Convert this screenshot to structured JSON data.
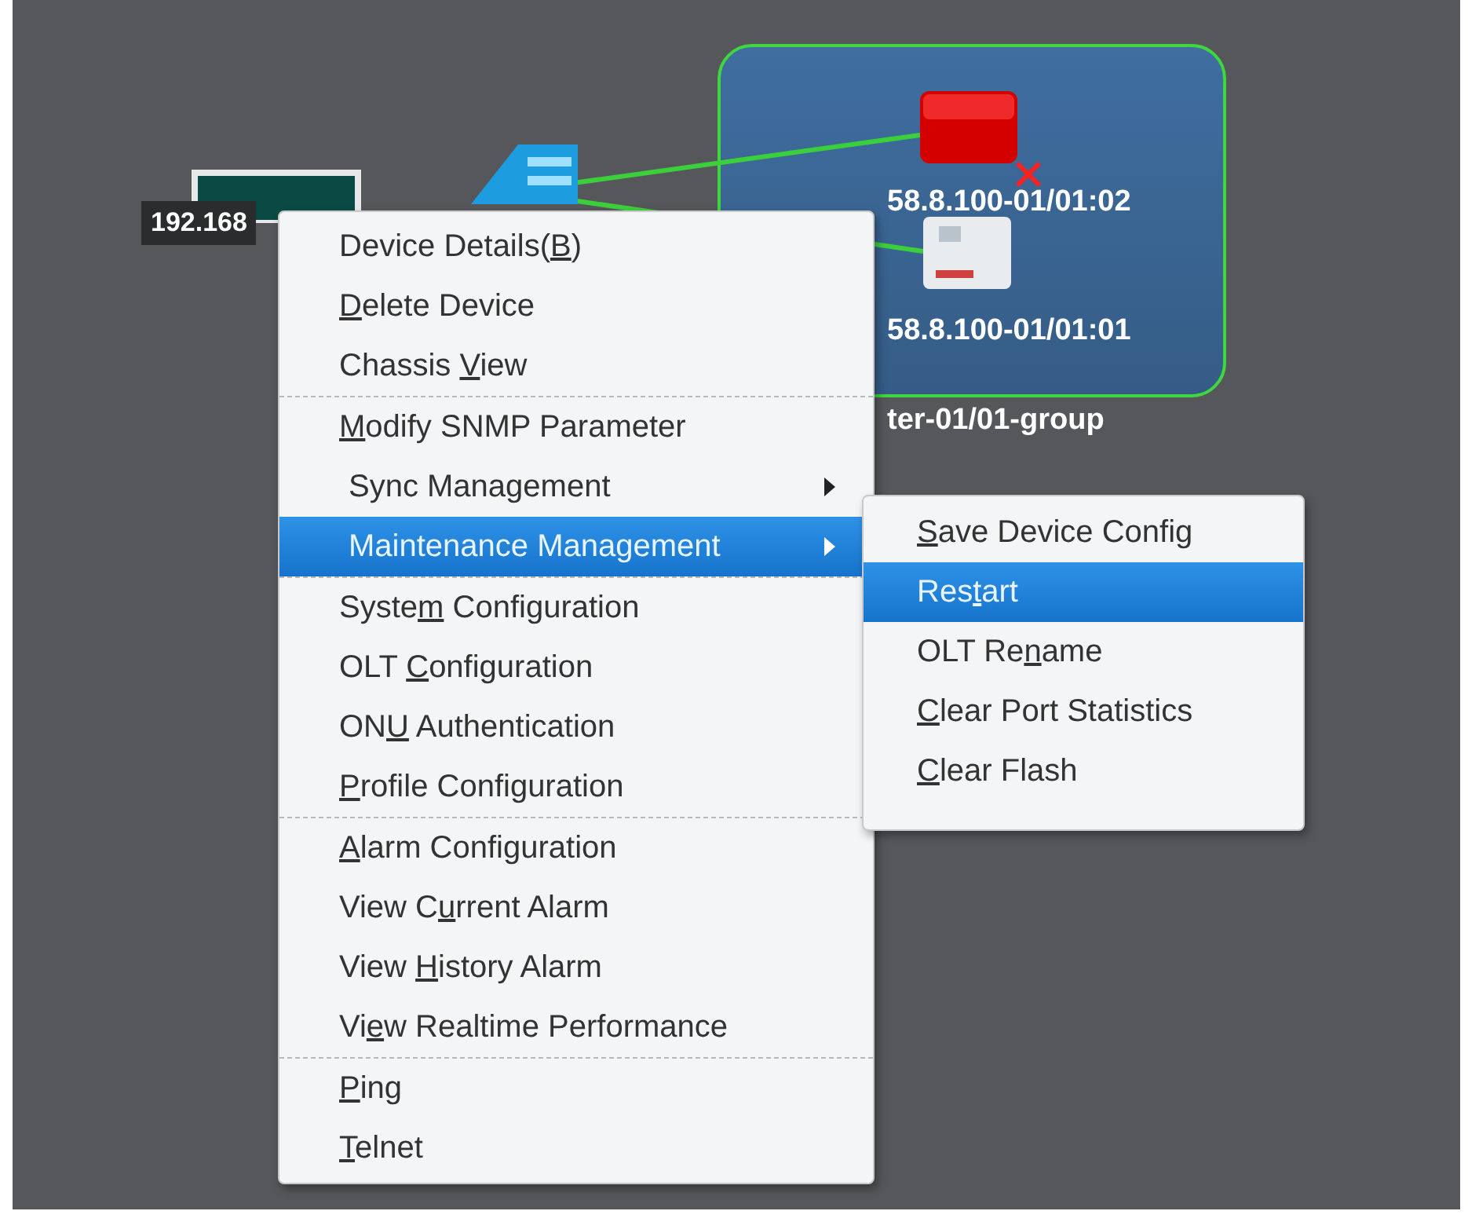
{
  "canvas": {
    "labels": [
      {
        "kind": "tag",
        "text": "192.168"
      },
      {
        "kind": "plain",
        "text": "58.8.100-01/01:02"
      },
      {
        "kind": "plain",
        "text": "58.8.100-01/01:01"
      },
      {
        "kind": "plain",
        "text": "ter-01/01-group"
      }
    ]
  },
  "context_menu": {
    "items": [
      {
        "kind": "item",
        "before": "Device Details(",
        "key": "B",
        "after": ")",
        "selected": false
      },
      {
        "kind": "item",
        "key": "D",
        "after": "elete Device",
        "selected": false
      },
      {
        "kind": "item",
        "before": "Chassis ",
        "key": "V",
        "after": "iew",
        "selected": false
      },
      {
        "kind": "separator"
      },
      {
        "kind": "item",
        "key": "M",
        "after": "odify SNMP Parameter",
        "selected": false
      },
      {
        "kind": "submenu",
        "before": "Sync Management",
        "selected": false
      },
      {
        "kind": "submenu",
        "before": "Maintenance Management",
        "selected": true
      },
      {
        "kind": "separator"
      },
      {
        "kind": "item",
        "before": "Syste",
        "key": "m",
        "after": " Configuration",
        "selected": false
      },
      {
        "kind": "item",
        "before": "OLT ",
        "key": "C",
        "after": "onfiguration",
        "selected": false
      },
      {
        "kind": "item",
        "before": "ON",
        "key": "U",
        "after": " Authentication",
        "selected": false
      },
      {
        "kind": "item",
        "key": "P",
        "after": "rofile Configuration",
        "selected": false
      },
      {
        "kind": "separator"
      },
      {
        "kind": "item",
        "key": "A",
        "after": "larm Configuration",
        "selected": false
      },
      {
        "kind": "item",
        "before": "View C",
        "key": "u",
        "after": "rrent Alarm",
        "selected": false
      },
      {
        "kind": "item",
        "before": "View ",
        "key": "H",
        "after": "istory Alarm",
        "selected": false
      },
      {
        "kind": "item",
        "before": "Vi",
        "key": "e",
        "after": "w Realtime Performance",
        "selected": false
      },
      {
        "kind": "separator"
      },
      {
        "kind": "item",
        "key": "P",
        "after": "ing",
        "selected": false
      },
      {
        "kind": "item",
        "key": "T",
        "after": "elnet",
        "selected": false
      }
    ]
  },
  "submenu": {
    "items": [
      {
        "kind": "item",
        "key": "S",
        "after": "ave Device Config",
        "selected": false
      },
      {
        "kind": "item",
        "before": "Res",
        "key": "t",
        "after": "art",
        "selected": true
      },
      {
        "kind": "item",
        "before": "OLT Re",
        "key": "n",
        "after": "ame",
        "selected": false
      },
      {
        "kind": "item",
        "key": "C",
        "after": "lear Port Statistics",
        "selected": false
      },
      {
        "kind": "item",
        "key": "C",
        "after": "lear Flash",
        "selected": false
      }
    ]
  }
}
